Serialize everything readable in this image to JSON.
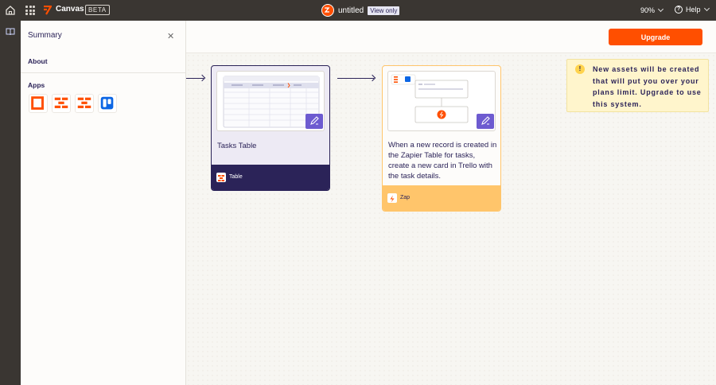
{
  "topbar": {
    "app_name": "Canvas",
    "badge": "BETA",
    "doc_title": "untitled",
    "mode_badge": "View only",
    "zoom": "90%",
    "help_label": "Help",
    "icons": [
      "home-icon",
      "app-grid-icon",
      "zapier-logo",
      "zoom-chevron-icon",
      "help-icon",
      "help-chevron-icon"
    ]
  },
  "sidebar": {
    "icons": [
      "book-icon"
    ]
  },
  "summary_panel": {
    "title": "Summary",
    "about_label": "About",
    "apps_label": "Apps",
    "apps": [
      {
        "name": "interfaces",
        "icon": "interfaces-app-icon"
      },
      {
        "name": "tables",
        "icon": "tables-app-icon"
      },
      {
        "name": "tables",
        "icon": "tables-app-icon"
      },
      {
        "name": "trello",
        "icon": "trello-app-icon"
      }
    ]
  },
  "header": {
    "upgrade_label": "Upgrade"
  },
  "canvas": {
    "cards": [
      {
        "title": "Tasks Table",
        "type_label": "Table"
      },
      {
        "title": "When a new record is created in the Zapier Table for tasks, create a new card in Trello with the task details.",
        "type_label": "Zap"
      }
    ]
  },
  "warning": {
    "text": "New assets will be created that will put you over your plans limit. Upgrade to use this system."
  },
  "colors": {
    "brand_orange": "#ff4f00",
    "navy": "#2b2358",
    "topbar": "#3a3632",
    "edit_purple": "#6d5bd0",
    "zap_yellow": "#ffc56b",
    "warning_bg": "#fff5cc"
  }
}
